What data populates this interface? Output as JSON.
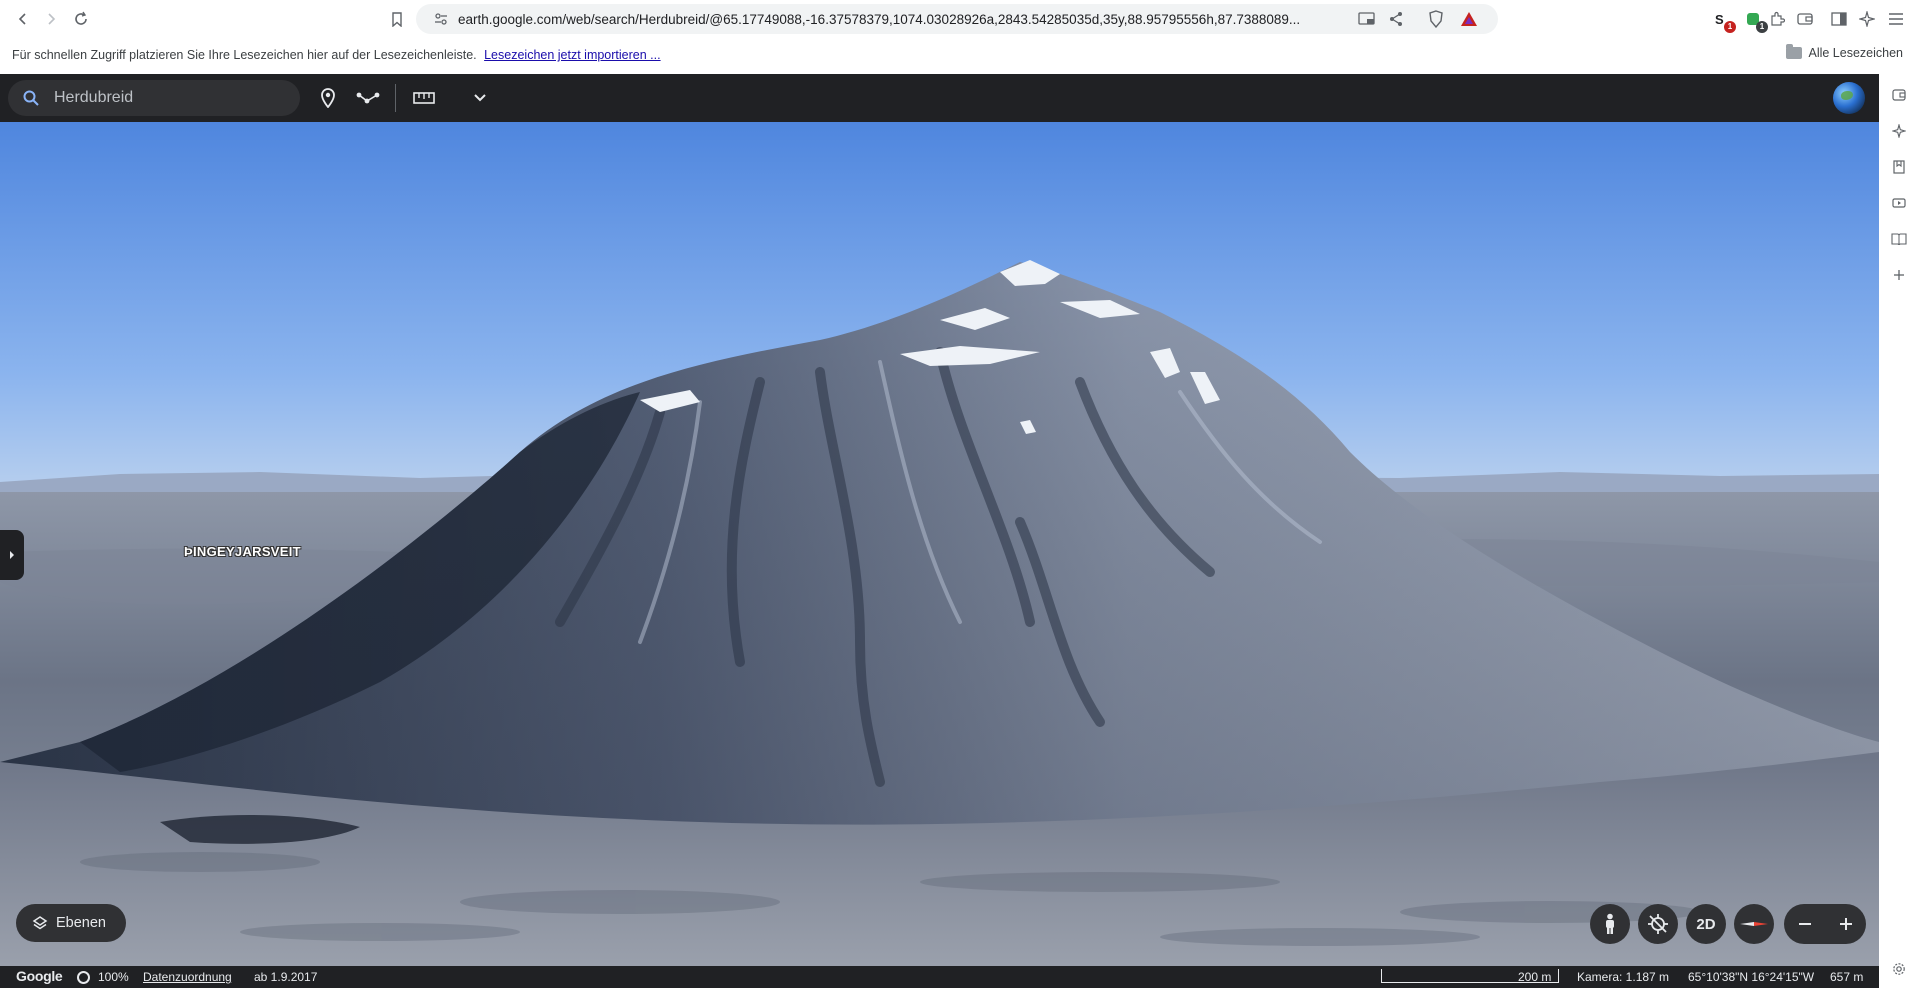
{
  "browser": {
    "url": "earth.google.com/web/search/Herdubreid/@65.17749088,-16.37578379,1074.03028926a,2843.54285035d,35y,88.95795556h,87.7388089...",
    "extensions": {
      "badge_one": "1",
      "badge_two": "1"
    }
  },
  "bookmarks_bar": {
    "hint_text": "Für schnellen Zugriff platzieren Sie Ihre Lesezeichen hier auf der Lesezeichenleiste.",
    "import_link": "Lesezeichen jetzt importieren ...",
    "all_bookmarks": "Alle Lesezeichen"
  },
  "earth": {
    "search": {
      "value": "Herdubreid"
    },
    "place_label": "ÞINGEYJARSVEIT",
    "layers_button": "Ebenen",
    "view_toggle": "2D",
    "status": {
      "google": "Google",
      "percent": "100%",
      "attribution": "Datenzuordnung",
      "imagery_date": "ab 1.9.2017",
      "scale": "200 m",
      "camera": "Kamera: 1.187 m",
      "coordinates": "65°10'38\"N 16°24'15\"W",
      "elevation": "657 m"
    }
  },
  "colors": {
    "topbar": "#202124",
    "panel": "#303134",
    "sky_top": "#4f86de",
    "sky_horizon": "#a9c9f2",
    "mountain_dark": "#3b4659",
    "mountain_light": "#9aa5b8",
    "snow": "#eef2f7",
    "danger_icon": "#c5221f"
  }
}
